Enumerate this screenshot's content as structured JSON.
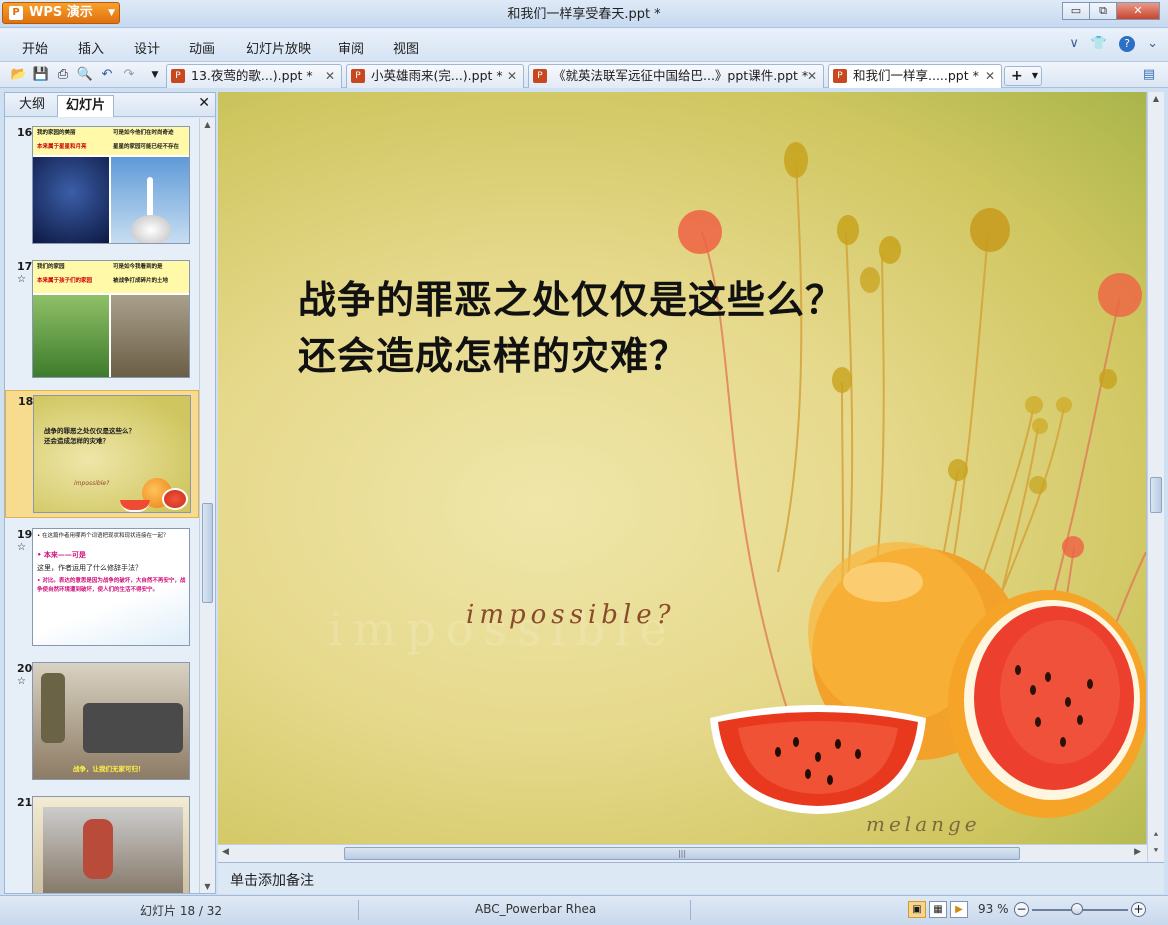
{
  "app": {
    "brand_label": "WPS 演示",
    "window_title": "和我们一样享受春天.ppt *"
  },
  "window_controls": {
    "minimize": "▭",
    "restore": "⧉",
    "close": "✕"
  },
  "menus": [
    "开始",
    "插入",
    "设计",
    "动画",
    "幻灯片放映",
    "审阅",
    "视图"
  ],
  "doc_tabs": [
    {
      "label": "13.夜莺的歌...).ppt *"
    },
    {
      "label": "小英雄雨来(完...).ppt *"
    },
    {
      "label": "《就英法联军远征中国给巴...》ppt课件.ppt *"
    },
    {
      "label": "和我们一样享.....ppt *"
    }
  ],
  "left_panel": {
    "tabs": [
      "大纲",
      "幻灯片"
    ],
    "slides": [
      {
        "num": "16",
        "star": "",
        "line1": "我的家园的美丽",
        "line2": "本来属于星星和月亮",
        "r1": "可是如今他们在时尚奇迹",
        "r2": "星星的家园可能已经不存在"
      },
      {
        "num": "17",
        "star": "☆",
        "line1": "我们的家园",
        "line2": "本来属于孩子们的家园",
        "r1": "可是如今我看到的是",
        "r2": "被战争打成碎片的土地"
      },
      {
        "num": "18",
        "star": "",
        "line1": "战争的罪恶之处仅仅是这些么？",
        "line2": "还会造成怎样的灾难？",
        "r1": "impossible?",
        "r2": ""
      },
      {
        "num": "19",
        "star": "☆",
        "line1": "• 在这篇作者用哪两个词语把现状和现状连接在一起？",
        "line2": "• 本来——可是",
        "r1": "这里，作者运用了什么修辞手法？",
        "r2": "• 对比。表达的意思是因为战争的破坏，大自然不再安宁，战争使自然环境遭到破坏，使人们的生活不得安宁。"
      },
      {
        "num": "20",
        "star": "☆",
        "line1": "战争，让我们无家可归！",
        "line2": "",
        "r1": "",
        "r2": ""
      },
      {
        "num": "21",
        "star": "",
        "line1": "",
        "line2": "",
        "r1": "",
        "r2": ""
      }
    ]
  },
  "slide": {
    "title_line1": "战争的罪恶之处仅仅是这些么？",
    "title_line2": "还会造成怎样的灾难？",
    "impossible": "impossible?",
    "ghost": "impossible",
    "melange": "melange"
  },
  "notes_placeholder": "单击添加备注",
  "status": {
    "slide_counter": "幻灯片 18 / 32",
    "theme": "ABC_Powerbar Rhea",
    "zoom": "93 %",
    "zoom_fraction": 0.43
  }
}
